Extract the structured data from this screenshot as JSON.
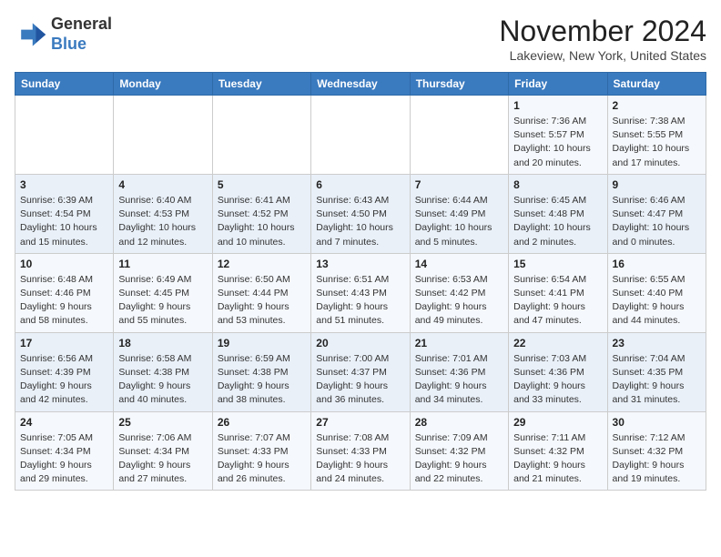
{
  "header": {
    "logo_line1": "General",
    "logo_line2": "Blue",
    "month": "November 2024",
    "location": "Lakeview, New York, United States"
  },
  "weekdays": [
    "Sunday",
    "Monday",
    "Tuesday",
    "Wednesday",
    "Thursday",
    "Friday",
    "Saturday"
  ],
  "weeks": [
    [
      {
        "day": "",
        "info": ""
      },
      {
        "day": "",
        "info": ""
      },
      {
        "day": "",
        "info": ""
      },
      {
        "day": "",
        "info": ""
      },
      {
        "day": "",
        "info": ""
      },
      {
        "day": "1",
        "info": "Sunrise: 7:36 AM\nSunset: 5:57 PM\nDaylight: 10 hours and 20 minutes."
      },
      {
        "day": "2",
        "info": "Sunrise: 7:38 AM\nSunset: 5:55 PM\nDaylight: 10 hours and 17 minutes."
      }
    ],
    [
      {
        "day": "3",
        "info": "Sunrise: 6:39 AM\nSunset: 4:54 PM\nDaylight: 10 hours and 15 minutes."
      },
      {
        "day": "4",
        "info": "Sunrise: 6:40 AM\nSunset: 4:53 PM\nDaylight: 10 hours and 12 minutes."
      },
      {
        "day": "5",
        "info": "Sunrise: 6:41 AM\nSunset: 4:52 PM\nDaylight: 10 hours and 10 minutes."
      },
      {
        "day": "6",
        "info": "Sunrise: 6:43 AM\nSunset: 4:50 PM\nDaylight: 10 hours and 7 minutes."
      },
      {
        "day": "7",
        "info": "Sunrise: 6:44 AM\nSunset: 4:49 PM\nDaylight: 10 hours and 5 minutes."
      },
      {
        "day": "8",
        "info": "Sunrise: 6:45 AM\nSunset: 4:48 PM\nDaylight: 10 hours and 2 minutes."
      },
      {
        "day": "9",
        "info": "Sunrise: 6:46 AM\nSunset: 4:47 PM\nDaylight: 10 hours and 0 minutes."
      }
    ],
    [
      {
        "day": "10",
        "info": "Sunrise: 6:48 AM\nSunset: 4:46 PM\nDaylight: 9 hours and 58 minutes."
      },
      {
        "day": "11",
        "info": "Sunrise: 6:49 AM\nSunset: 4:45 PM\nDaylight: 9 hours and 55 minutes."
      },
      {
        "day": "12",
        "info": "Sunrise: 6:50 AM\nSunset: 4:44 PM\nDaylight: 9 hours and 53 minutes."
      },
      {
        "day": "13",
        "info": "Sunrise: 6:51 AM\nSunset: 4:43 PM\nDaylight: 9 hours and 51 minutes."
      },
      {
        "day": "14",
        "info": "Sunrise: 6:53 AM\nSunset: 4:42 PM\nDaylight: 9 hours and 49 minutes."
      },
      {
        "day": "15",
        "info": "Sunrise: 6:54 AM\nSunset: 4:41 PM\nDaylight: 9 hours and 47 minutes."
      },
      {
        "day": "16",
        "info": "Sunrise: 6:55 AM\nSunset: 4:40 PM\nDaylight: 9 hours and 44 minutes."
      }
    ],
    [
      {
        "day": "17",
        "info": "Sunrise: 6:56 AM\nSunset: 4:39 PM\nDaylight: 9 hours and 42 minutes."
      },
      {
        "day": "18",
        "info": "Sunrise: 6:58 AM\nSunset: 4:38 PM\nDaylight: 9 hours and 40 minutes."
      },
      {
        "day": "19",
        "info": "Sunrise: 6:59 AM\nSunset: 4:38 PM\nDaylight: 9 hours and 38 minutes."
      },
      {
        "day": "20",
        "info": "Sunrise: 7:00 AM\nSunset: 4:37 PM\nDaylight: 9 hours and 36 minutes."
      },
      {
        "day": "21",
        "info": "Sunrise: 7:01 AM\nSunset: 4:36 PM\nDaylight: 9 hours and 34 minutes."
      },
      {
        "day": "22",
        "info": "Sunrise: 7:03 AM\nSunset: 4:36 PM\nDaylight: 9 hours and 33 minutes."
      },
      {
        "day": "23",
        "info": "Sunrise: 7:04 AM\nSunset: 4:35 PM\nDaylight: 9 hours and 31 minutes."
      }
    ],
    [
      {
        "day": "24",
        "info": "Sunrise: 7:05 AM\nSunset: 4:34 PM\nDaylight: 9 hours and 29 minutes."
      },
      {
        "day": "25",
        "info": "Sunrise: 7:06 AM\nSunset: 4:34 PM\nDaylight: 9 hours and 27 minutes."
      },
      {
        "day": "26",
        "info": "Sunrise: 7:07 AM\nSunset: 4:33 PM\nDaylight: 9 hours and 26 minutes."
      },
      {
        "day": "27",
        "info": "Sunrise: 7:08 AM\nSunset: 4:33 PM\nDaylight: 9 hours and 24 minutes."
      },
      {
        "day": "28",
        "info": "Sunrise: 7:09 AM\nSunset: 4:32 PM\nDaylight: 9 hours and 22 minutes."
      },
      {
        "day": "29",
        "info": "Sunrise: 7:11 AM\nSunset: 4:32 PM\nDaylight: 9 hours and 21 minutes."
      },
      {
        "day": "30",
        "info": "Sunrise: 7:12 AM\nSunset: 4:32 PM\nDaylight: 9 hours and 19 minutes."
      }
    ]
  ]
}
